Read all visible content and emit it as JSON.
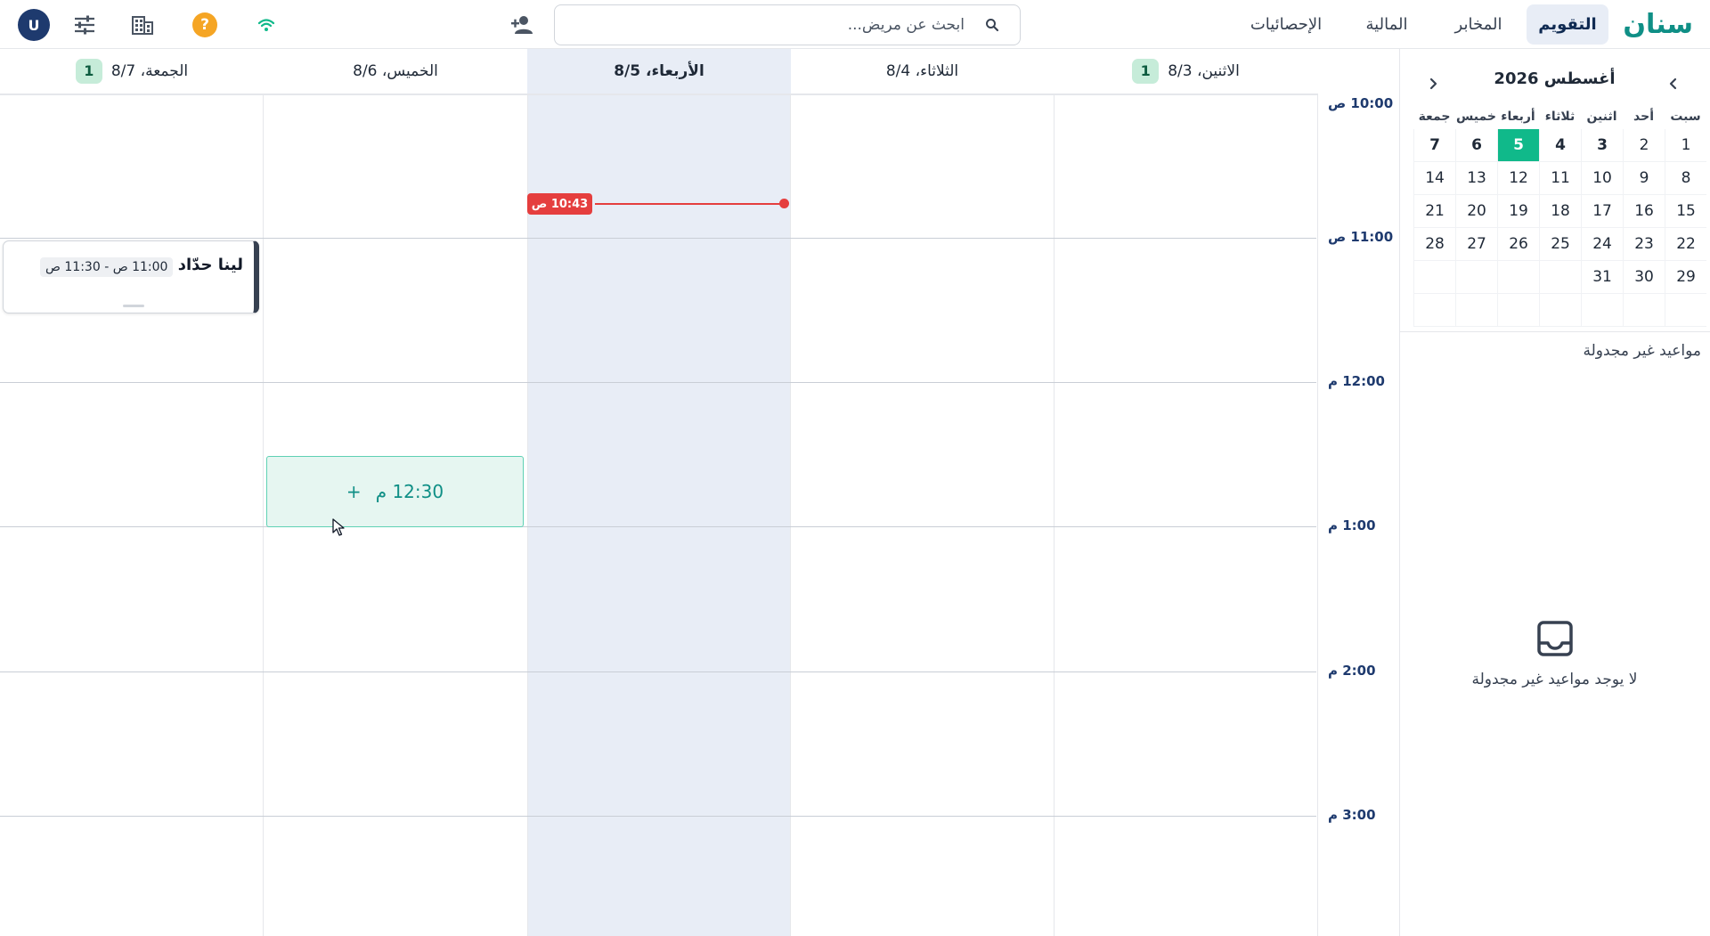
{
  "app": {
    "brand": "سنان"
  },
  "nav": {
    "tabs": [
      {
        "label": "التقويم",
        "active": true
      },
      {
        "label": "المخابر"
      },
      {
        "label": "المالية"
      },
      {
        "label": "الإحصائيات"
      }
    ]
  },
  "search": {
    "placeholder": "ابحث عن مريض...",
    "value": ""
  },
  "toolbar": {
    "add_patient_icon": "person-add-icon",
    "wifi_icon": "wifi-icon",
    "help_label": "?",
    "building_icon": "building-icon",
    "settings_icon": "sliders-icon",
    "avatar_initial": "U"
  },
  "mini_calendar": {
    "title": "أغسطس 2026",
    "weekdays": [
      "سبت",
      "أحد",
      "اثنين",
      "ثلاثاء",
      "أربعاء",
      "خميس",
      "جمعة"
    ],
    "weeks": [
      [
        "1",
        "2",
        "3",
        "4",
        "5",
        "6",
        "7"
      ],
      [
        "8",
        "9",
        "10",
        "11",
        "12",
        "13",
        "14"
      ],
      [
        "15",
        "16",
        "17",
        "18",
        "19",
        "20",
        "21"
      ],
      [
        "22",
        "23",
        "24",
        "25",
        "26",
        "27",
        "28"
      ],
      [
        "29",
        "30",
        "31",
        "",
        "",
        "",
        ""
      ],
      [
        "",
        "",
        "",
        "",
        "",
        "",
        ""
      ]
    ],
    "today": "5",
    "current_week": [
      "3",
      "4",
      "5",
      "6",
      "7"
    ]
  },
  "unscheduled": {
    "title": "مواعيد غير مجدولة",
    "empty_text": "لا يوجد مواعيد غير مجدولة"
  },
  "week": {
    "days": [
      {
        "label": "الاثنين، 8/3",
        "count": "1"
      },
      {
        "label": "الثلاثاء، 8/4",
        "count": ""
      },
      {
        "label": "الأربعاء، 8/5",
        "count": "",
        "today": true
      },
      {
        "label": "الخميس، 8/6",
        "count": ""
      },
      {
        "label": "الجمعة، 8/7",
        "count": "1"
      }
    ],
    "time_labels": [
      "10:00 ص",
      "11:00 ص",
      "12:00 م",
      "1:00 م",
      "2:00 م",
      "3:00 م"
    ],
    "now_label": "10:43 ص"
  },
  "appointment": {
    "patient": "لينا حدّاد",
    "time": "11:00 ص - 11:30 ص"
  },
  "new_slot": {
    "plus": "+",
    "time": "12:30 م"
  },
  "colors": {
    "brand": "#0f8f86",
    "today_highlight": "#10b98a",
    "now_indicator": "#e53e3e",
    "count_badge": "#c6ecd9"
  }
}
